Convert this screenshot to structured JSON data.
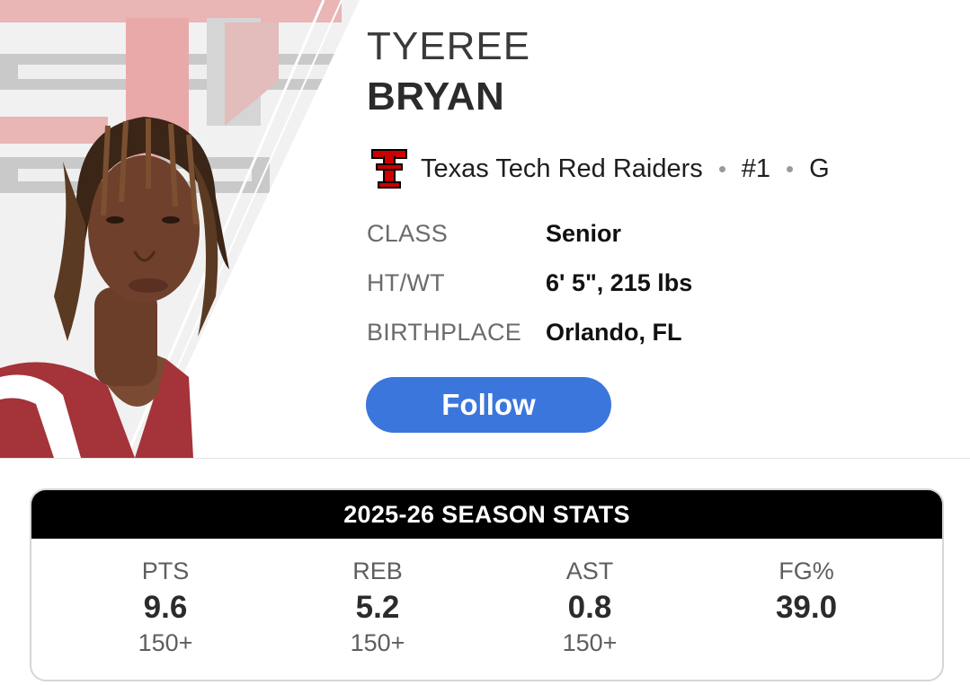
{
  "player": {
    "first_name": "TYEREE",
    "last_name": "BRYAN",
    "team": "Texas Tech Red Raiders",
    "number": "#1",
    "position": "G"
  },
  "info": [
    {
      "label": "CLASS",
      "value": "Senior"
    },
    {
      "label": "HT/WT",
      "value": "6' 5\", 215 lbs"
    },
    {
      "label": "BIRTHPLACE",
      "value": "Orlando, FL"
    }
  ],
  "follow_label": "Follow",
  "stats": {
    "title": "2025-26 SEASON STATS",
    "columns": [
      {
        "label": "PTS",
        "value": "9.6",
        "rank": "150+"
      },
      {
        "label": "REB",
        "value": "5.2",
        "rank": "150+"
      },
      {
        "label": "AST",
        "value": "0.8",
        "rank": "150+"
      },
      {
        "label": "FG%",
        "value": "39.0",
        "rank": ""
      }
    ]
  },
  "colors": {
    "accent": "#3b76dc",
    "team_red": "#cc0000",
    "header_bg": "#000000"
  },
  "icons": {
    "team_logo": "texas-tech-logo-icon",
    "player_photo": "player-headshot"
  }
}
